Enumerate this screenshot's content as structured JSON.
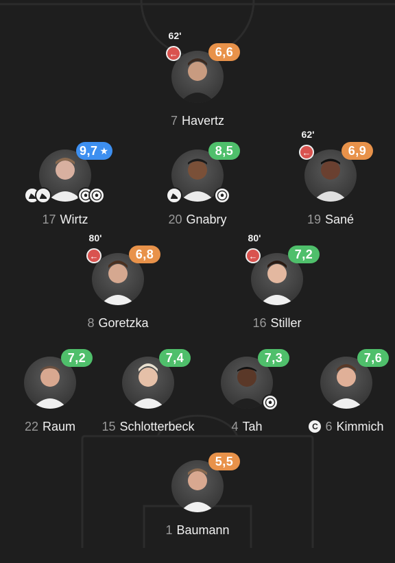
{
  "players": [
    {
      "id": "havertz",
      "number": "7",
      "name": "Havertz",
      "rating": "6,6",
      "rating_color": "#e8924a",
      "sub_time": "62'"
    },
    {
      "id": "wirtz",
      "number": "17",
      "name": "Wirtz",
      "rating": "9,7",
      "rating_color": "#3d8ff0",
      "star": "★"
    },
    {
      "id": "gnabry",
      "number": "20",
      "name": "Gnabry",
      "rating": "8,5",
      "rating_color": "#4fbf6b"
    },
    {
      "id": "sane",
      "number": "19",
      "name": "Sané",
      "rating": "6,9",
      "rating_color": "#e8924a",
      "sub_time": "62'"
    },
    {
      "id": "goretzka",
      "number": "8",
      "name": "Goretzka",
      "rating": "6,8",
      "rating_color": "#e8924a",
      "sub_time": "80'"
    },
    {
      "id": "stiller",
      "number": "16",
      "name": "Stiller",
      "rating": "7,2",
      "rating_color": "#4fbf6b",
      "sub_time": "80'"
    },
    {
      "id": "raum",
      "number": "22",
      "name": "Raum",
      "rating": "7,2",
      "rating_color": "#4fbf6b"
    },
    {
      "id": "schlotterbeck",
      "number": "15",
      "name": "Schlotterbeck",
      "rating": "7,4",
      "rating_color": "#4fbf6b"
    },
    {
      "id": "tah",
      "number": "4",
      "name": "Tah",
      "rating": "7,3",
      "rating_color": "#4fbf6b"
    },
    {
      "id": "kimmich",
      "number": "6",
      "name": "Kimmich",
      "rating": "7,6",
      "rating_color": "#4fbf6b",
      "captain": "C"
    },
    {
      "id": "baumann",
      "number": "1",
      "name": "Baumann",
      "rating": "5,5",
      "rating_color": "#e8924a"
    }
  ],
  "icons": {
    "sub_out": "arrow-left-icon",
    "assist": "boot-icon",
    "goal": "football-icon",
    "captain": "captain-armband-icon",
    "motm": "star-icon"
  },
  "subout_glyph": "←"
}
